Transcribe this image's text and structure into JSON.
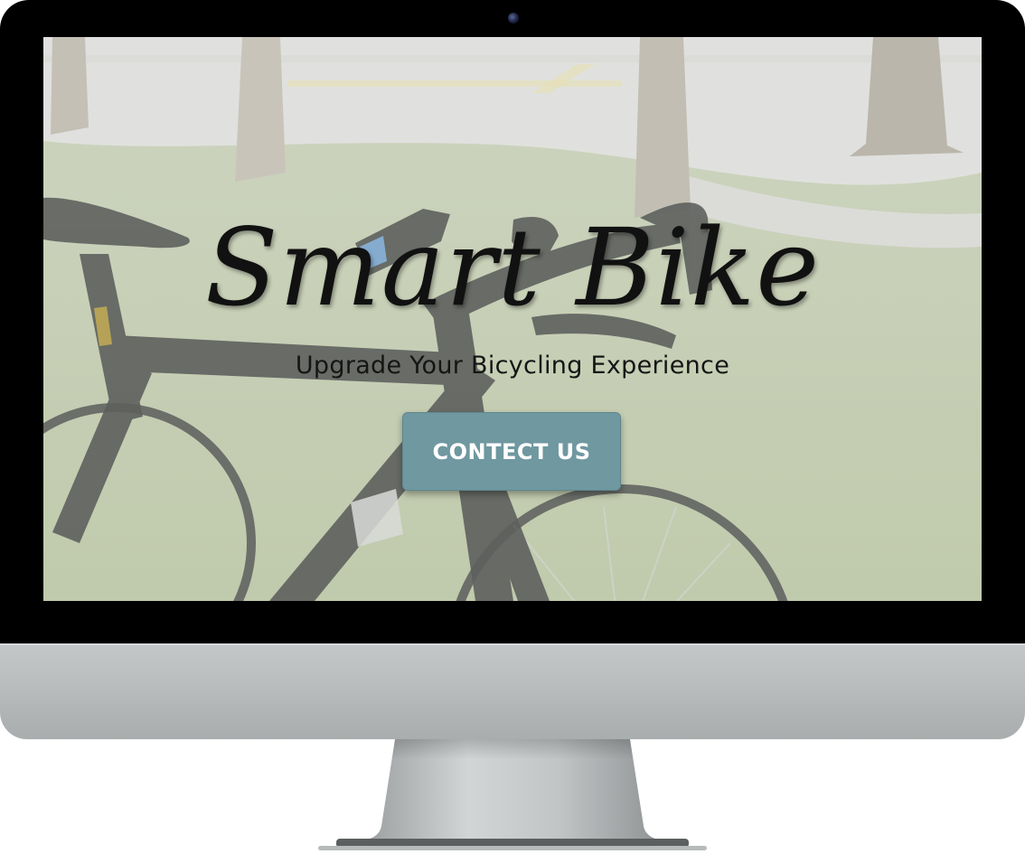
{
  "device": {
    "type": "desktop-monitor",
    "bezel_color": "#000000",
    "chassis_color": "#b8bcbd"
  },
  "hero": {
    "title": "Smart Bike",
    "subtitle": "Upgrade Your Bicycling Experience",
    "cta_label": "CONTECT US",
    "cta_color": "#6f98a0",
    "background_image": "bicycle-on-grass-photo"
  }
}
